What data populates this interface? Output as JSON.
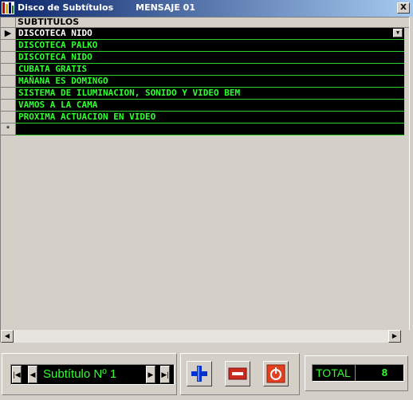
{
  "window": {
    "title": "Disco de Subtítulos",
    "subtitle": "MENSAJE 01",
    "close_label": "X"
  },
  "grid": {
    "column_header": "SUBTITULOS",
    "current_row_marker": "▶",
    "new_row_marker": "*",
    "dropdown_arrow": "▼",
    "rows": [
      "DISCOTECA NIDO",
      "DISCOTECA PALKO",
      "DISCOTECA NIDO",
      "CUBATA GRATIS",
      "MAÑANA ES DOMINGO",
      "SISTEMA DE ILUMINACION, SONIDO Y VIDEO BEM",
      "VAMOS A LA CAMA",
      "PROXIMA ACTUACION EN VIDEO"
    ]
  },
  "scrollbar": {
    "left_arrow": "◀",
    "right_arrow": "▶"
  },
  "navigator": {
    "first": "|◀",
    "prev": "◀",
    "label": "Subtítulo Nº 1",
    "next": "▶",
    "last": "▶|"
  },
  "toolbar": {
    "add_icon": "plus-icon",
    "remove_icon": "minus-icon",
    "power_icon": "power-icon",
    "colors": {
      "add": "#0033cc",
      "remove": "#cc2a1f",
      "power": "#e04020"
    }
  },
  "total": {
    "label": "TOTAL",
    "value": "8"
  },
  "colors": {
    "text_green": "#2fff2f",
    "grid_bg": "#000000",
    "face": "#d4d0c8"
  }
}
